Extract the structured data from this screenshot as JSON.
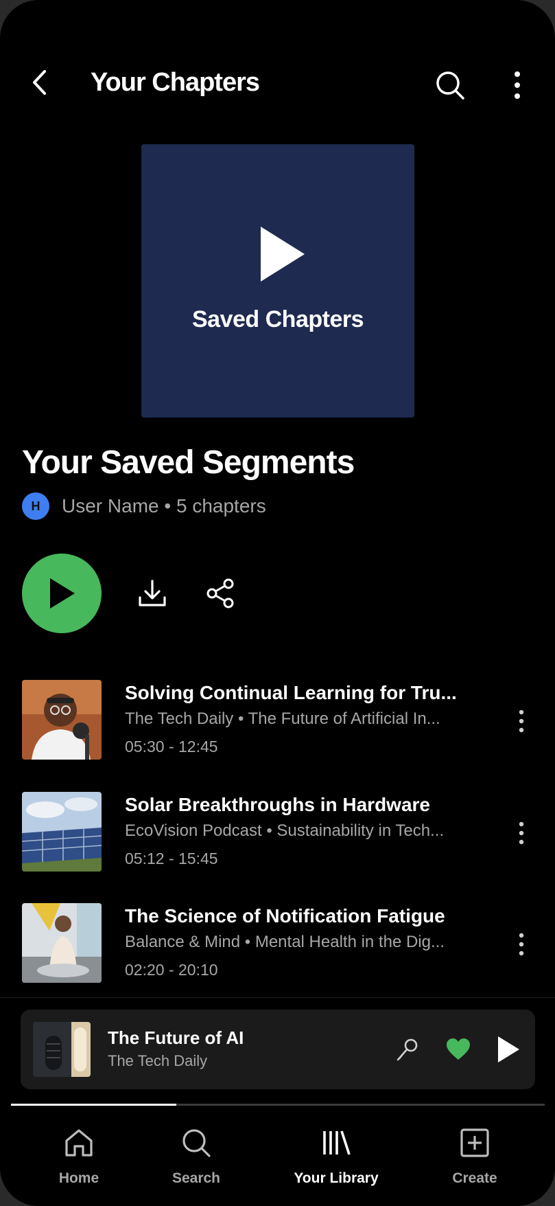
{
  "header": {
    "title": "Your Chapters"
  },
  "cover": {
    "label": "Saved Chapters",
    "color": "#1e2a4f"
  },
  "playlist": {
    "title": "Your Saved Segments",
    "avatar_initial": "H",
    "owner": "User Name",
    "meta": "5 chapters",
    "accent_color": "#47b85c"
  },
  "tracks": [
    {
      "title": "Solving Continual Learning for Tru...",
      "subtitle": "The Tech Daily • The Future of Artificial In...",
      "time_range": "05:30 - 12:45"
    },
    {
      "title": "Solar Breakthroughs in Hardware",
      "subtitle": "EcoVision Podcast • Sustainability in Tech...",
      "time_range": "05:12 - 15:45"
    },
    {
      "title": "The Science of Notification Fatigue",
      "subtitle": "Balance & Mind • Mental Health in the Dig...",
      "time_range": "02:20 - 20:10"
    }
  ],
  "mini_player": {
    "title": "The Future of AI",
    "subtitle": "The Tech Daily",
    "liked": true,
    "progress": 0.31
  },
  "nav": {
    "items": [
      {
        "label": "Home",
        "icon": "home-icon"
      },
      {
        "label": "Search",
        "icon": "search-icon"
      },
      {
        "label": "Your Library",
        "icon": "library-icon",
        "active": true
      },
      {
        "label": "Create",
        "icon": "create-icon"
      }
    ]
  }
}
